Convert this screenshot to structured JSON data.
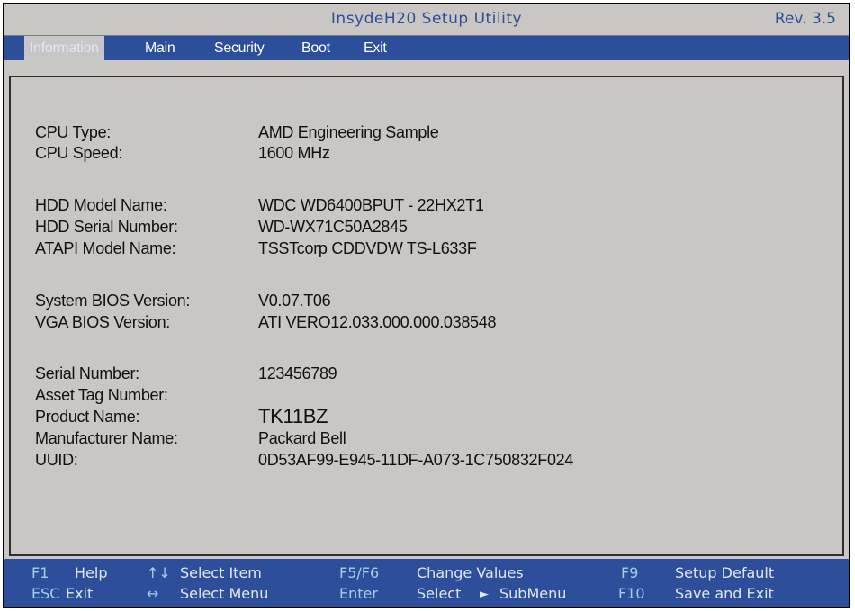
{
  "window": {
    "title": "InsydeH20 Setup Utility",
    "revision": "Rev.  3.5"
  },
  "menu": {
    "tabs": [
      {
        "label": "Information",
        "active": true
      },
      {
        "label": "Main",
        "active": false
      },
      {
        "label": "Security",
        "active": false
      },
      {
        "label": "Boot",
        "active": false
      },
      {
        "label": "Exit",
        "active": false
      }
    ]
  },
  "info": {
    "cpu_type": {
      "label": "CPU Type:",
      "value": "AMD Engineering Sample"
    },
    "cpu_speed": {
      "label": "CPU Speed:",
      "value": "1600 MHz"
    },
    "hdd_model": {
      "label": "HDD Model Name:",
      "value": "WDC WD6400BPUT - 22HX2T1"
    },
    "hdd_serial": {
      "label": "HDD Serial Number:",
      "value": "WD-WX71C50A2845"
    },
    "atapi_model": {
      "label": "ATAPI Model Name:",
      "value": "TSSTcorp CDDVDW TS-L633F"
    },
    "system_bios": {
      "label": "System BIOS Version:",
      "value": "V0.07.T06"
    },
    "vga_bios": {
      "label": "VGA BIOS Version:",
      "value": "ATI VERO12.033.000.000.038548"
    },
    "serial_number": {
      "label": "Serial Number:",
      "value": "123456789"
    },
    "asset_tag": {
      "label": "Asset Tag Number:",
      "value": ""
    },
    "product_name": {
      "label": "Product Name:",
      "value": "TK11BZ"
    },
    "manufacturer": {
      "label": "Manufacturer Name:",
      "value": "Packard Bell"
    },
    "uuid": {
      "label": "UUID:",
      "value": "0D53AF99-E945-11DF-A073-1C750832F024"
    }
  },
  "footer": {
    "f1_key": "F1",
    "f1_text": "Help",
    "updown_key": "↑↓",
    "updown_text": "Select  Item",
    "f5f6_key": "F5/F6",
    "f5f6_text": "Change  Values",
    "f9_key": "F9",
    "f9_text": "Setup  Default",
    "esc_key": "ESC",
    "esc_text": "Exit",
    "leftright_key": "↔",
    "leftright_text": "Select  Menu",
    "enter_key": "Enter",
    "enter_text": "Select",
    "submenu_text": "SubMenu",
    "f10_key": "F10",
    "f10_text": "Save  and  Exit"
  },
  "colors": {
    "menu_bar": "#2d4f9b",
    "title_text": "#2c4f9a",
    "background": "#c9c6c4",
    "footer_key": "#9fd2e6"
  }
}
